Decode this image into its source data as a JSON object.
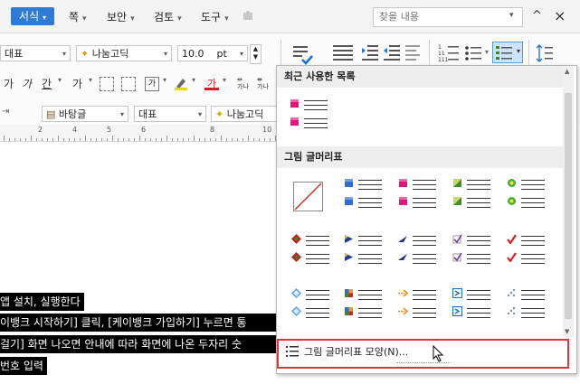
{
  "menu": {
    "active": "서식",
    "items": [
      "쪽",
      "보안",
      "검토",
      "도구"
    ],
    "search_placeholder": "찾을 내용",
    "up": "^",
    "close": "×"
  },
  "toolbar": {
    "para_style": "대표",
    "font_name": "나눔고딕",
    "font_size": "10.0",
    "unit": "pt",
    "row2_glyphs": [
      "가",
      "가",
      "간",
      "가"
    ],
    "style2": "바탕글",
    "style3": "대표",
    "font3": "나눔고딕"
  },
  "ruler": {
    "labels": [
      "2",
      "4",
      "5",
      "6",
      "8",
      "10"
    ]
  },
  "document": {
    "lines": [
      "앱 설치, 실행한다",
      "이뱅크 시작하기] 클릭, [케이뱅크 가입하기] 누르면 통",
      "걸기] 화면 나오면 안내에 따라 화면에 나온 두자리 숫",
      "번호 입력"
    ]
  },
  "panel": {
    "recent_title": "최근 사용한 목록",
    "picture_title": "그림 글머리표",
    "footer_label": "그림 글머리표 모양(N)..."
  },
  "bullets": {
    "recent": [
      {
        "color": "#e3147b",
        "shape": "square"
      }
    ],
    "rows": [
      [
        {
          "name": "none",
          "color": "#d03030",
          "shape": "none"
        },
        {
          "name": "blue-square",
          "color": "#2a6fd6",
          "shape": "square"
        },
        {
          "name": "pink-square",
          "color": "#e3147b",
          "shape": "square"
        },
        {
          "name": "green-triangle",
          "color": "#3f8f22",
          "shape": "triangle"
        },
        {
          "name": "green-circle",
          "color": "#44b02a",
          "shape": "circle"
        }
      ],
      [
        {
          "name": "red-diamond",
          "color": "#c02020",
          "shape": "cross"
        },
        {
          "name": "blue-triangle",
          "color": "#1a3da0",
          "shape": "play"
        },
        {
          "name": "navy-arrow",
          "color": "#2b2c8c",
          "shape": "arrow"
        },
        {
          "name": "check-box",
          "color": "#6b2fb0",
          "shape": "check-box"
        },
        {
          "name": "red-check",
          "color": "#d82222",
          "shape": "check"
        }
      ],
      [
        {
          "name": "blue-diamond",
          "color": "#5aa0e0",
          "shape": "diamond"
        },
        {
          "name": "four-square",
          "color": "#e8a020",
          "shape": "quad"
        },
        {
          "name": "orange-arrow",
          "color": "#f08c1a",
          "shape": "dash-arrow"
        },
        {
          "name": "boxed-arrow",
          "color": "#1f6fc6",
          "shape": "boxed"
        },
        {
          "name": "dots",
          "color": "#7a8fc8",
          "shape": "dots"
        }
      ]
    ]
  }
}
